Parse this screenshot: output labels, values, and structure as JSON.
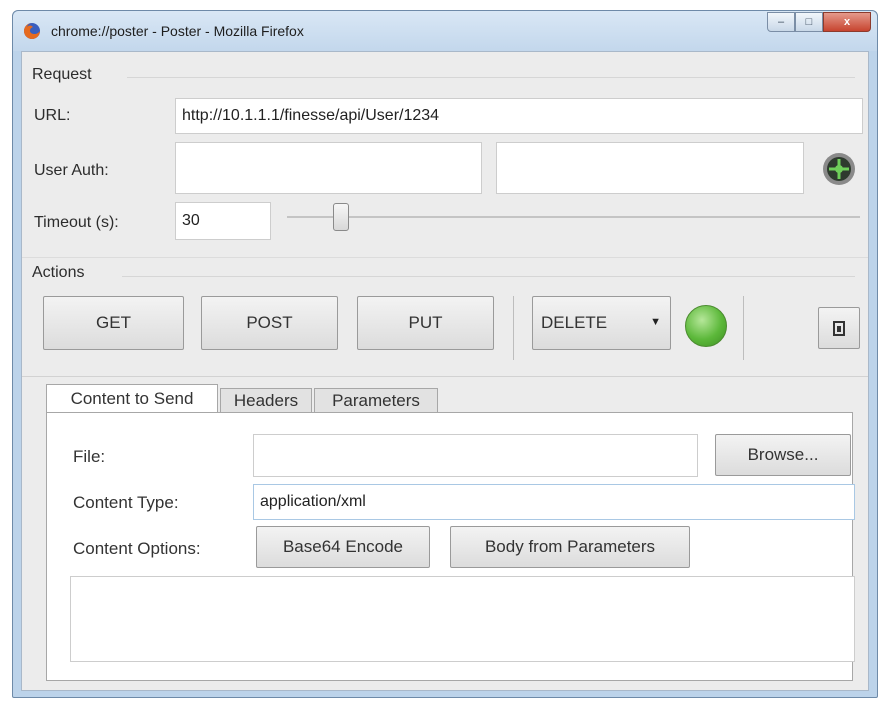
{
  "window": {
    "title": "chrome://poster - Poster - Mozilla Firefox",
    "close_glyph": "x",
    "maximize_glyph": "□",
    "minimize_glyph": "–"
  },
  "request": {
    "section_label": "Request",
    "url_label": "URL:",
    "url_value": "http://10.1.1.1/finesse/api/User/1234",
    "user_auth_label": "User Auth:",
    "user_value": "",
    "password_value": "",
    "timeout_label": "Timeout (s):",
    "timeout_value": "30"
  },
  "actions": {
    "section_label": "Actions",
    "get": "GET",
    "post": "POST",
    "put": "PUT",
    "method_selected": "DELETE",
    "dropdown_glyph": "▼",
    "status_color": "#5cb83a"
  },
  "tabs": [
    {
      "label": "Content to Send",
      "active": true
    },
    {
      "label": "Headers",
      "active": false
    },
    {
      "label": "Parameters",
      "active": false
    }
  ],
  "content": {
    "file_label": "File:",
    "file_value": "",
    "browse": "Browse...",
    "content_type_label": "Content Type:",
    "content_type_value": "application/xml",
    "options_label": "Content Options:",
    "base64": "Base64 Encode",
    "body_from_params": "Body from Parameters",
    "body_value": ""
  }
}
